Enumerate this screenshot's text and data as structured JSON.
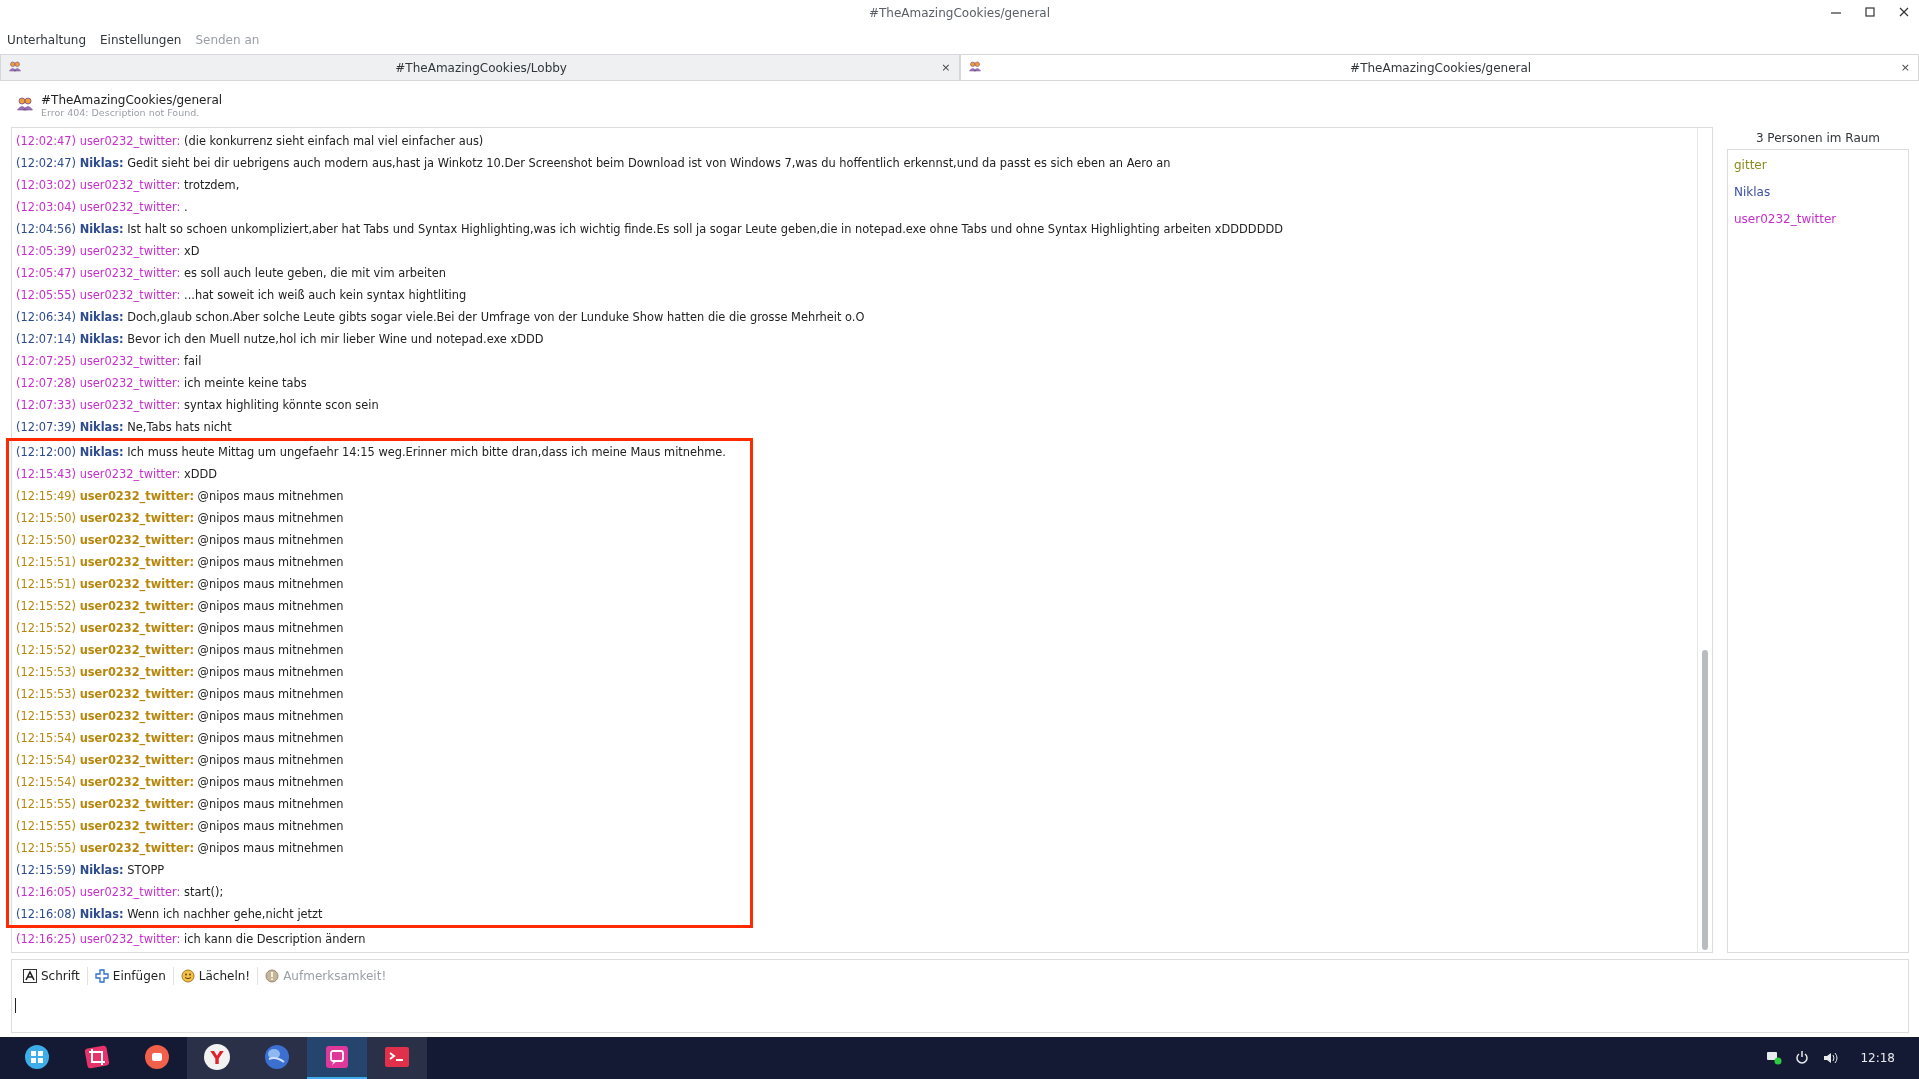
{
  "window": {
    "title": "#TheAmazingCookies/general"
  },
  "menu": [
    {
      "label": "Unterhaltung",
      "disabled": false
    },
    {
      "label": "Einstellungen",
      "disabled": false
    },
    {
      "label": "Senden an",
      "disabled": true
    }
  ],
  "tabs": [
    {
      "label": "#TheAmazingCookies/Lobby",
      "selected": false,
      "close": "×"
    },
    {
      "label": "#TheAmazingCookies/general",
      "selected": true,
      "close": "×"
    }
  ],
  "room": {
    "name": "#TheAmazingCookies/general",
    "description": "Error 404: Description not Found."
  },
  "messages": [
    {
      "time": "(12:02:47)",
      "nick": "user0232_twitter:",
      "text": "(die konkurrenz sieht einfach mal viel einfacher aus)",
      "kind": "other",
      "boxed": false
    },
    {
      "time": "(12:02:47)",
      "nick": "Niklas:",
      "text": "Gedit sieht bei dir uebrigens auch modern aus,hast ja Winkotz 10.Der Screenshot beim Download ist von Windows 7,was du hoffentlich erkennst,und da passt es sich eben an Aero an",
      "kind": "self",
      "boxed": false
    },
    {
      "time": "(12:03:02)",
      "nick": "user0232_twitter:",
      "text": "trotzdem,",
      "kind": "other",
      "boxed": false
    },
    {
      "time": "(12:03:04)",
      "nick": "user0232_twitter:",
      "text": ".",
      "kind": "other",
      "boxed": false
    },
    {
      "time": "(12:04:56)",
      "nick": "Niklas:",
      "text": "Ist halt so schoen unkompliziert,aber hat Tabs und Syntax Highlighting,was ich wichtig finde.Es soll ja sogar Leute geben,die in notepad.exe ohne Tabs und ohne Syntax Highlighting arbeiten xDDDDDDD",
      "kind": "self",
      "boxed": false
    },
    {
      "time": "(12:05:39)",
      "nick": "user0232_twitter:",
      "text": "xD",
      "kind": "other",
      "boxed": false
    },
    {
      "time": "(12:05:47)",
      "nick": "user0232_twitter:",
      "text": "es soll auch leute geben, die mit vim arbeiten",
      "kind": "other",
      "boxed": false
    },
    {
      "time": "(12:05:55)",
      "nick": "user0232_twitter:",
      "text": "...hat soweit ich weiß auch kein syntax hightliting",
      "kind": "other",
      "boxed": false
    },
    {
      "time": "(12:06:34)",
      "nick": "Niklas:",
      "text": "Doch,glaub schon.Aber solche Leute gibts sogar viele.Bei der Umfrage von der Lunduke Show hatten die die grosse Mehrheit o.O",
      "kind": "self",
      "boxed": false
    },
    {
      "time": "(12:07:14)",
      "nick": "Niklas:",
      "text": "Bevor ich den Muell nutze,hol ich mir lieber Wine und notepad.exe xDDD",
      "kind": "self",
      "boxed": false
    },
    {
      "time": "(12:07:25)",
      "nick": "user0232_twitter:",
      "text": "fail",
      "kind": "other",
      "boxed": false
    },
    {
      "time": "(12:07:28)",
      "nick": "user0232_twitter:",
      "text": "ich meinte keine tabs",
      "kind": "other",
      "boxed": false
    },
    {
      "time": "(12:07:33)",
      "nick": "user0232_twitter:",
      "text": "syntax highliting könnte scon sein",
      "kind": "other",
      "boxed": false
    },
    {
      "time": "(12:07:39)",
      "nick": "Niklas:",
      "text": "Ne,Tabs hats nicht",
      "kind": "self",
      "boxed": false
    },
    {
      "time": "(12:12:00)",
      "nick": "Niklas:",
      "text": "Ich muss heute Mittag um ungefaehr 14:15 weg.Erinner mich bitte dran,dass ich meine Maus mitnehme.",
      "kind": "self",
      "boxed": true
    },
    {
      "time": "(12:15:43)",
      "nick": "user0232_twitter:",
      "text": "xDDD",
      "kind": "other",
      "boxed": true
    },
    {
      "time": "(12:15:49)",
      "nick": "user0232_twitter:",
      "text": "@nipos maus mitnehmen",
      "kind": "mention",
      "boxed": true
    },
    {
      "time": "(12:15:50)",
      "nick": "user0232_twitter:",
      "text": "@nipos maus mitnehmen",
      "kind": "mention",
      "boxed": true
    },
    {
      "time": "(12:15:50)",
      "nick": "user0232_twitter:",
      "text": "@nipos maus mitnehmen",
      "kind": "mention",
      "boxed": true
    },
    {
      "time": "(12:15:51)",
      "nick": "user0232_twitter:",
      "text": "@nipos maus mitnehmen",
      "kind": "mention",
      "boxed": true
    },
    {
      "time": "(12:15:51)",
      "nick": "user0232_twitter:",
      "text": "@nipos maus mitnehmen",
      "kind": "mention",
      "boxed": true
    },
    {
      "time": "(12:15:52)",
      "nick": "user0232_twitter:",
      "text": "@nipos maus mitnehmen",
      "kind": "mention",
      "boxed": true
    },
    {
      "time": "(12:15:52)",
      "nick": "user0232_twitter:",
      "text": "@nipos maus mitnehmen",
      "kind": "mention",
      "boxed": true
    },
    {
      "time": "(12:15:52)",
      "nick": "user0232_twitter:",
      "text": "@nipos maus mitnehmen",
      "kind": "mention",
      "boxed": true
    },
    {
      "time": "(12:15:53)",
      "nick": "user0232_twitter:",
      "text": "@nipos maus mitnehmen",
      "kind": "mention",
      "boxed": true
    },
    {
      "time": "(12:15:53)",
      "nick": "user0232_twitter:",
      "text": "@nipos maus mitnehmen",
      "kind": "mention",
      "boxed": true
    },
    {
      "time": "(12:15:53)",
      "nick": "user0232_twitter:",
      "text": "@nipos maus mitnehmen",
      "kind": "mention",
      "boxed": true
    },
    {
      "time": "(12:15:54)",
      "nick": "user0232_twitter:",
      "text": "@nipos maus mitnehmen",
      "kind": "mention",
      "boxed": true
    },
    {
      "time": "(12:15:54)",
      "nick": "user0232_twitter:",
      "text": "@nipos maus mitnehmen",
      "kind": "mention",
      "boxed": true
    },
    {
      "time": "(12:15:54)",
      "nick": "user0232_twitter:",
      "text": "@nipos maus mitnehmen",
      "kind": "mention",
      "boxed": true
    },
    {
      "time": "(12:15:55)",
      "nick": "user0232_twitter:",
      "text": "@nipos maus mitnehmen",
      "kind": "mention",
      "boxed": true
    },
    {
      "time": "(12:15:55)",
      "nick": "user0232_twitter:",
      "text": "@nipos maus mitnehmen",
      "kind": "mention",
      "boxed": true
    },
    {
      "time": "(12:15:55)",
      "nick": "user0232_twitter:",
      "text": "@nipos maus mitnehmen",
      "kind": "mention",
      "boxed": true
    },
    {
      "time": "(12:15:59)",
      "nick": "Niklas:",
      "text": "STOPP",
      "kind": "self",
      "boxed": true
    },
    {
      "time": "(12:16:05)",
      "nick": "user0232_twitter:",
      "text": "start();",
      "kind": "other",
      "boxed": true
    },
    {
      "time": "(12:16:08)",
      "nick": "Niklas:",
      "text": "Wenn ich nachher gehe,nicht jetzt",
      "kind": "self",
      "boxed": true
    },
    {
      "time": "(12:16:25)",
      "nick": "user0232_twitter:",
      "text": "ich kann die Description ändern",
      "kind": "other",
      "boxed": false
    }
  ],
  "people": {
    "title": "3 Personen im Raum",
    "items": [
      {
        "name": "gitter",
        "color": "#8a8a1e"
      },
      {
        "name": "Niklas",
        "color": "#3b4fa3"
      },
      {
        "name": "user0232_twitter",
        "color": "#c62fcb"
      }
    ]
  },
  "toolbar": [
    {
      "label": "Schrift",
      "kind": "font",
      "disabled": false
    },
    {
      "label": "Einfügen",
      "kind": "insert",
      "disabled": false
    },
    {
      "label": "Lächeln!",
      "kind": "smile",
      "disabled": false
    },
    {
      "label": "Aufmerksamkeit!",
      "kind": "attention",
      "disabled": true
    }
  ],
  "taskbar": {
    "items": [
      {
        "kind": "launcher",
        "open": false,
        "selected": false
      },
      {
        "kind": "crop",
        "open": false,
        "selected": false
      },
      {
        "kind": "record",
        "open": false,
        "selected": false
      },
      {
        "kind": "browser",
        "glyph": "Y",
        "open": true,
        "selected": false
      },
      {
        "kind": "globe",
        "open": true,
        "selected": false
      },
      {
        "kind": "chat",
        "open": true,
        "selected": true
      },
      {
        "kind": "terminal",
        "open": true,
        "selected": false
      }
    ],
    "clock": "12:18"
  }
}
